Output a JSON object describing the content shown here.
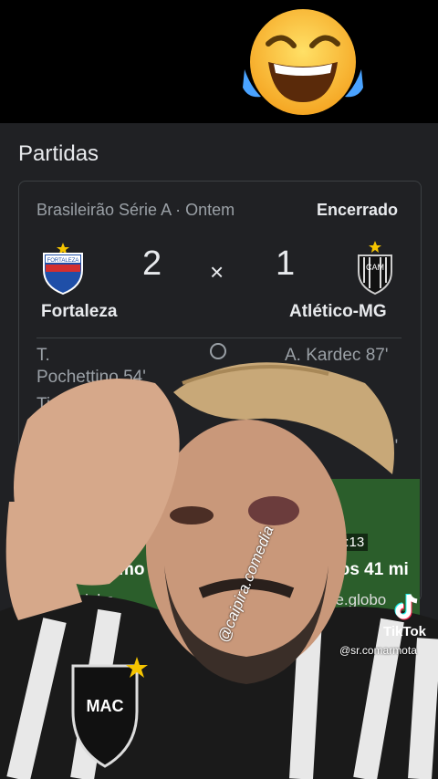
{
  "section_title": "Partidas",
  "match": {
    "league": "Brasileirão Série A · Ontem",
    "status": "Encerrado",
    "home": {
      "name": "Fortaleza",
      "score": "2",
      "badge_text": "FORTALEZA"
    },
    "away": {
      "name": "Atlético-MG",
      "score": "1",
      "badge_text": "CAM"
    },
    "separator": "×",
    "events": {
      "home_line1": "T.",
      "home_line2": "Pochettino 54'",
      "home_line3": "Ti",
      "away_line1": "A. Kardec 87'",
      "away_line2": "9'"
    }
  },
  "videos": [
    {
      "title": "mo da",
      "source": "ge.globo"
    },
    {
      "title": "Aos 41 mi",
      "source": "ge.globo",
      "duration": "0:13"
    }
  ],
  "overlay": {
    "tiktok_label": "TikTok",
    "tiktok_user": "@sr.comarmota",
    "watermark": "@caipira.comedia",
    "shirt_badge": "MAC"
  },
  "emoji": "laughing-with-tears"
}
